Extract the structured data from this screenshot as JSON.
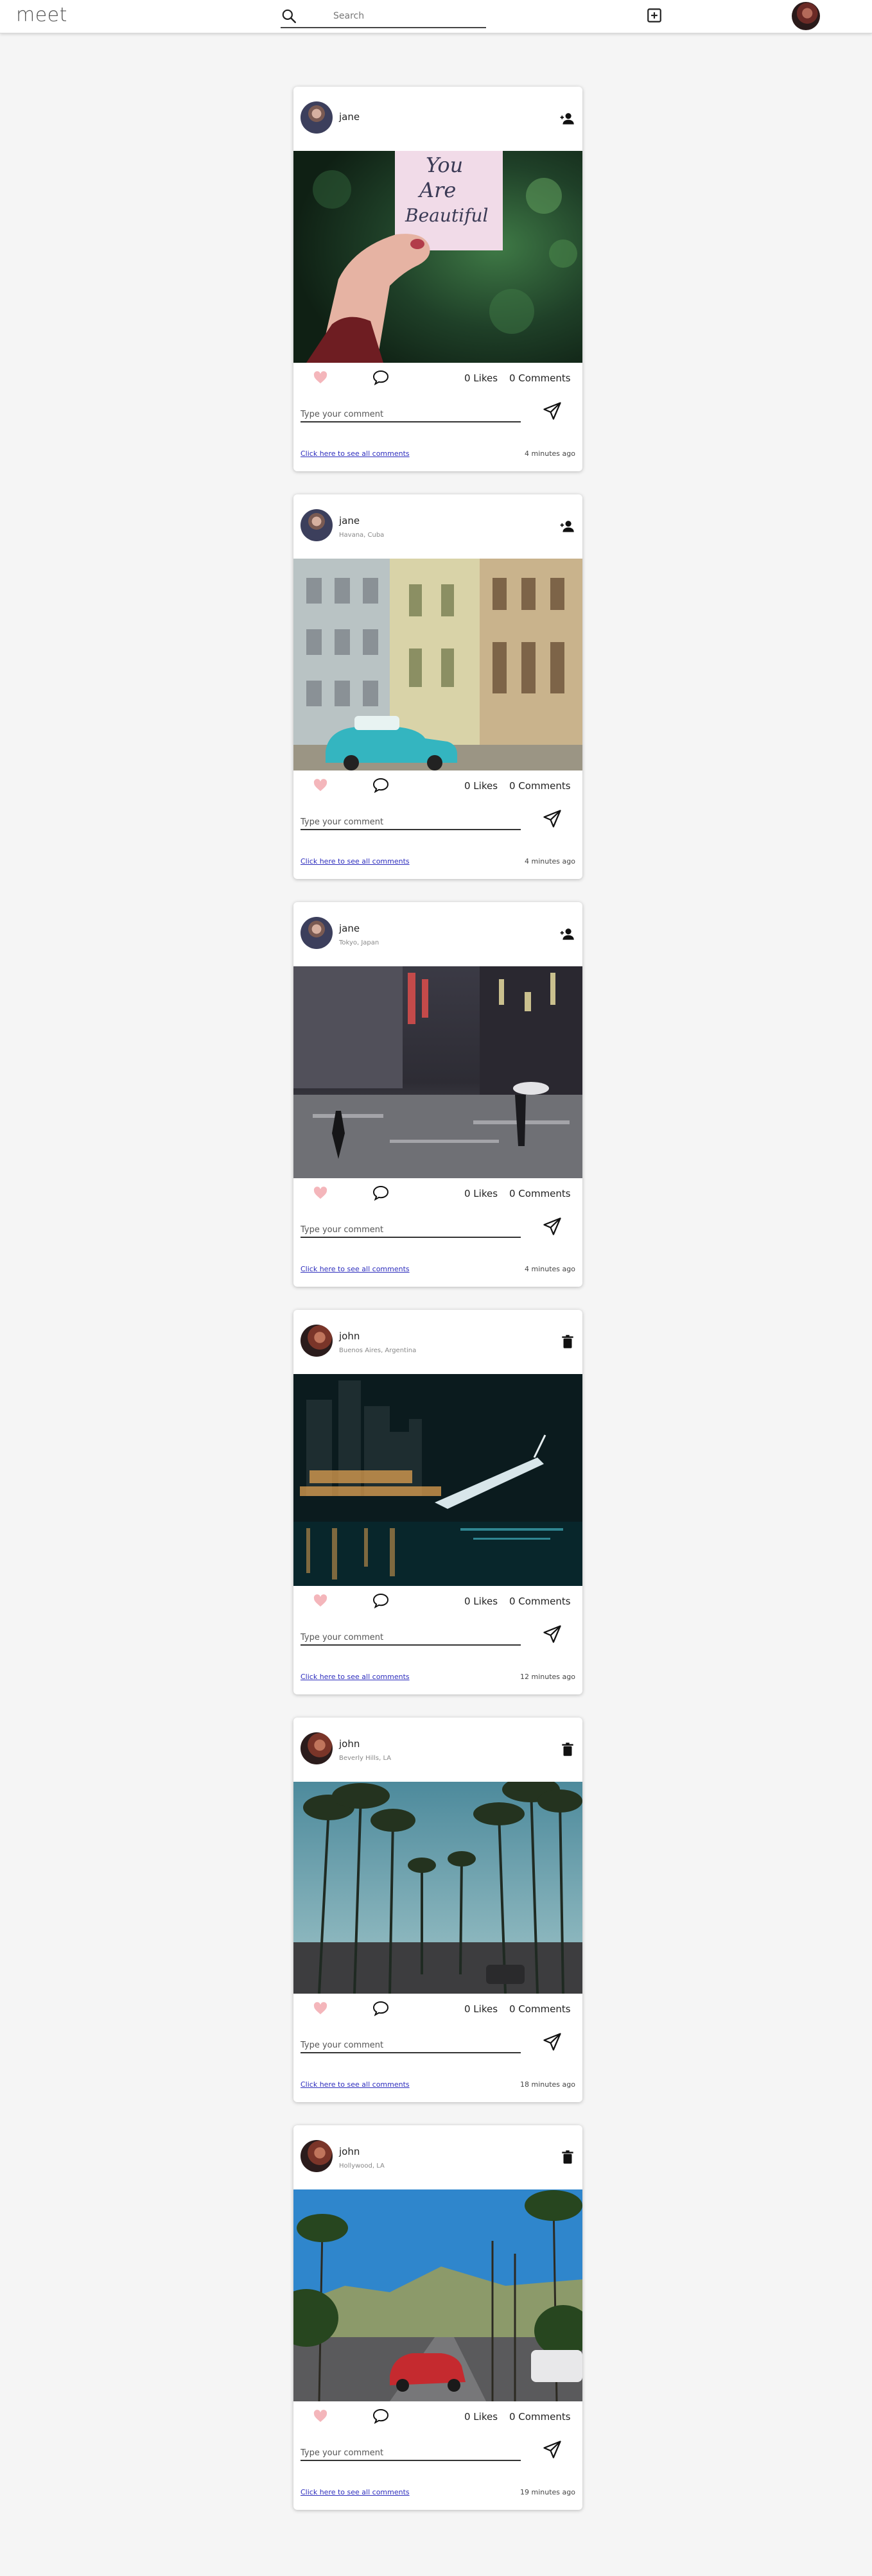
{
  "header": {
    "brand": "meet",
    "search_placeholder": "Search"
  },
  "posts": [
    {
      "username": "jane",
      "location": "",
      "likes": "0 Likes",
      "comments": "0 Comments",
      "comment_placeholder": "Type your comment",
      "see_all": "Click here to see all comments",
      "time": "4 minutes ago",
      "action_icon": "follow-icon",
      "photo": "sticky note with handwritten text held in hand",
      "photo_text": [
        "You",
        "Are",
        "Beautiful"
      ]
    },
    {
      "username": "jane",
      "location": "Havana, Cuba",
      "likes": "0 Likes",
      "comments": "0 Comments",
      "comment_placeholder": "Type your comment",
      "see_all": "Click here to see all comments",
      "time": "4 minutes ago",
      "action_icon": "follow-icon",
      "photo": "vintage turquoise car on a Havana street"
    },
    {
      "username": "jane",
      "location": "Tokyo, Japan",
      "likes": "0 Likes",
      "comments": "0 Comments",
      "comment_placeholder": "Type your comment",
      "see_all": "Click here to see all comments",
      "time": "4 minutes ago",
      "action_icon": "follow-icon",
      "photo": "rainy Tokyo street at night"
    },
    {
      "username": "john",
      "location": "Buenos Aires, Argentina",
      "likes": "0 Likes",
      "comments": "0 Comments",
      "comment_placeholder": "Type your comment",
      "see_all": "Click here to see all comments",
      "time": "12 minutes ago",
      "action_icon": "trash-icon",
      "photo": "Buenos Aires skyline and bridge at night"
    },
    {
      "username": "john",
      "location": "Beverly Hills, LA",
      "likes": "0 Likes",
      "comments": "0 Comments",
      "comment_placeholder": "Type your comment",
      "see_all": "Click here to see all comments",
      "time": "18 minutes ago",
      "action_icon": "trash-icon",
      "photo": "palm-lined street in Beverly Hills"
    },
    {
      "username": "john",
      "location": "Hollywood, LA",
      "likes": "0 Likes",
      "comments": "0 Comments",
      "comment_placeholder": "Type your comment",
      "see_all": "Click here to see all comments",
      "time": "19 minutes ago",
      "action_icon": "trash-icon",
      "photo": "red convertible on a Hollywood street with palm trees"
    }
  ],
  "colors": {
    "like": "#f4b6bb",
    "link": "#2d2dbd",
    "page_bg": "#f5f5f5"
  }
}
